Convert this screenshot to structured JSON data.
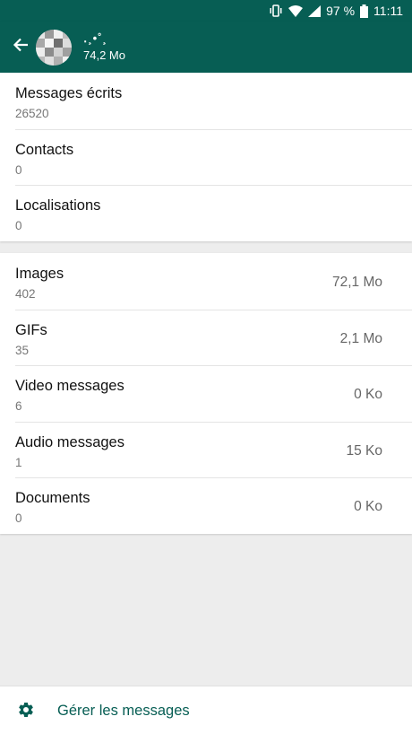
{
  "status_bar": {
    "battery": "97 %",
    "time": "11:11"
  },
  "header": {
    "chat_name": "․¸•˚¸",
    "total_size": "74,2 Mo"
  },
  "text_items": [
    {
      "label": "Messages écrits",
      "count": "26520"
    },
    {
      "label": "Contacts",
      "count": "0"
    },
    {
      "label": "Localisations",
      "count": "0"
    }
  ],
  "media_items": [
    {
      "label": "Images",
      "count": "402",
      "size": "72,1 Mo"
    },
    {
      "label": "GIFs",
      "count": "35",
      "size": "2,1 Mo"
    },
    {
      "label": "Video messages",
      "count": "6",
      "size": "0 Ko"
    },
    {
      "label": "Audio messages",
      "count": "1",
      "size": "15 Ko"
    },
    {
      "label": "Documents",
      "count": "0",
      "size": "0 Ko"
    }
  ],
  "footer": {
    "manage_label": "Gérer les messages"
  },
  "colors": {
    "primary": "#075e54",
    "background": "#ededed"
  },
  "icons": [
    "vibrate-icon",
    "wifi-icon",
    "signal-icon",
    "battery-icon",
    "back-arrow-icon",
    "gear-icon"
  ]
}
